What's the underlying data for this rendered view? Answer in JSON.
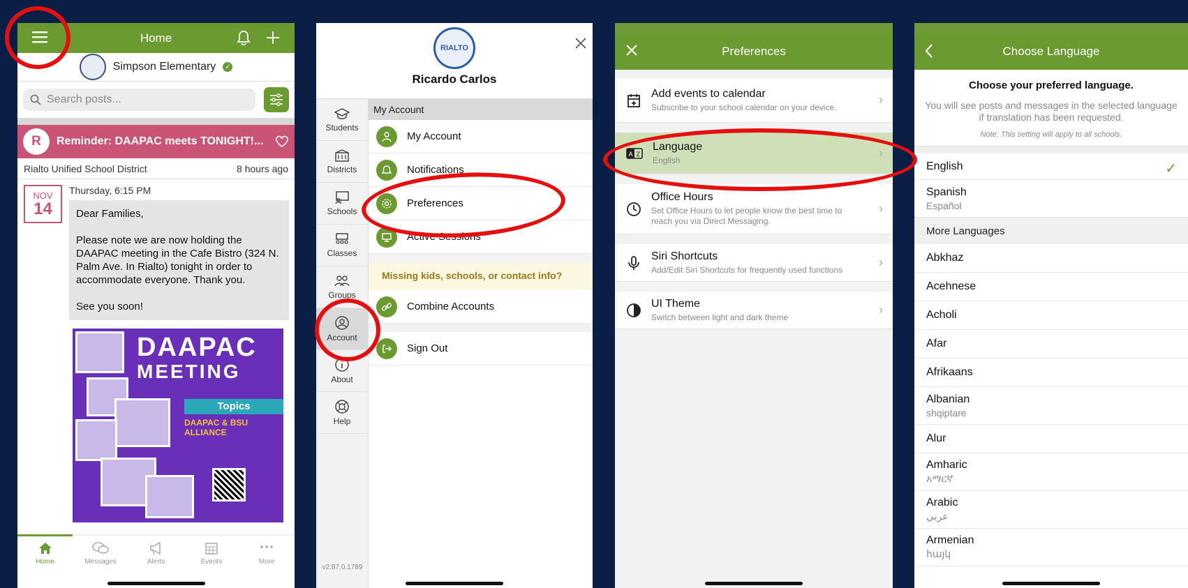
{
  "colors": {
    "brand_green": "#6a9a30",
    "alert_pink": "#c95474",
    "highlight_red": "#e41010",
    "background_navy": "#0b1e46"
  },
  "home": {
    "title": "Home",
    "school_name": "Simpson Elementary",
    "search_placeholder": "Search posts...",
    "alert": {
      "avatar_letter": "R",
      "title": "Reminder: DAAPAC meets TONIGHT!..."
    },
    "post_meta": {
      "source": "Rialto Unified School District",
      "time": "8 hours ago"
    },
    "post": {
      "month": "NOV",
      "day": "14",
      "time": "Thursday, 6:15 PM",
      "body": "Dear Families,\n\nPlease note we are now holding the DAAPAC meeting in the Cafe Bistro (324 N. Palm Ave. In Rialto) tonight in order to accommodate everyone. Thank you.\n\nSee you soon!"
    },
    "flyer": {
      "title": "DAAPAC",
      "subtitle": "MEETING",
      "topics": "Topics",
      "heading": "DAAPAC & BSU ALLIANCE"
    },
    "tabs": [
      "Home",
      "Messages",
      "Alerts",
      "Events",
      "More"
    ]
  },
  "account": {
    "district_logo_text": "RIALTO",
    "user_name": "Ricardo Carlos",
    "side_items": [
      "Students",
      "Districts",
      "Schools",
      "Classes",
      "Groups",
      "Account",
      "About",
      "Help"
    ],
    "section_header": "My Account",
    "items": [
      "My Account",
      "Notifications",
      "Preferences",
      "Active Sessions"
    ],
    "missing_banner": "Missing kids, schools, or contact info?",
    "combine": "Combine Accounts",
    "sign_out": "Sign Out",
    "version": "v2.87.0.1789"
  },
  "preferences": {
    "title": "Preferences",
    "rows": [
      {
        "title": "Add events to calendar",
        "subtitle": "Subscribe to your school calendar on your device."
      },
      {
        "title": "Language",
        "subtitle": "English"
      },
      {
        "title": "Office Hours",
        "subtitle": "Set Office Hours to let people know the best time to reach you via Direct Messaging."
      },
      {
        "title": "Siri Shortcuts",
        "subtitle": "Add/Edit Siri Shortcuts for frequently used functions"
      },
      {
        "title": "UI Theme",
        "subtitle": "Switch between light and dark theme"
      }
    ]
  },
  "language": {
    "title": "Choose Language",
    "heading": "Choose your preferred language.",
    "description": "You will see posts and messages in the selected language if translation has been requested.",
    "note": "Note: This setting will apply to all schools.",
    "selected": "English",
    "top": [
      {
        "name": "English",
        "native": ""
      },
      {
        "name": "Spanish",
        "native": "Español"
      }
    ],
    "more_header": "More Languages",
    "more": [
      {
        "name": "Abkhaz",
        "native": ""
      },
      {
        "name": "Acehnese",
        "native": ""
      },
      {
        "name": "Acholi",
        "native": ""
      },
      {
        "name": "Afar",
        "native": ""
      },
      {
        "name": "Afrikaans",
        "native": ""
      },
      {
        "name": "Albanian",
        "native": "shqiptare"
      },
      {
        "name": "Alur",
        "native": ""
      },
      {
        "name": "Amharic",
        "native": "አማርኛ"
      },
      {
        "name": "Arabic",
        "native": "عربي"
      },
      {
        "name": "Armenian",
        "native": "հայկ"
      }
    ]
  }
}
